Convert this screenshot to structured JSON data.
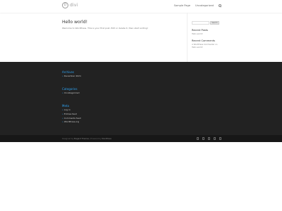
{
  "header": {
    "logo_mark": "D",
    "logo_text": "divi",
    "nav": [
      "Sample Page",
      "Uncategorized"
    ]
  },
  "post": {
    "title": "Hello world!",
    "excerpt": "Welcome to WordPress. This is your first post. Edit or delete it, then start writing!"
  },
  "sidebar": {
    "search_button": "Search",
    "recent_posts_heading": "Recent Posts",
    "recent_posts": [
      "Hello world!"
    ],
    "recent_comments_heading": "Recent Comments",
    "recent_comments": [
      "A WordPress Commenter on Hello world!"
    ]
  },
  "footer": {
    "archives_heading": "Archives",
    "archives": [
      "December 2021"
    ],
    "categories_heading": "Categories",
    "categories": [
      "Uncategorized"
    ],
    "meta_heading": "Meta",
    "meta": [
      "Log in",
      "Entries feed",
      "Comments feed",
      "WordPress.org"
    ]
  },
  "bottom": {
    "credits_prefix": "Designed by",
    "credits_theme": "Elegant Themes",
    "credits_sep": "| Powered by",
    "credits_wp": "WordPress"
  },
  "icons": [
    "facebook-icon",
    "twitter-icon",
    "google-plus-icon",
    "instagram-icon",
    "rss-icon"
  ]
}
